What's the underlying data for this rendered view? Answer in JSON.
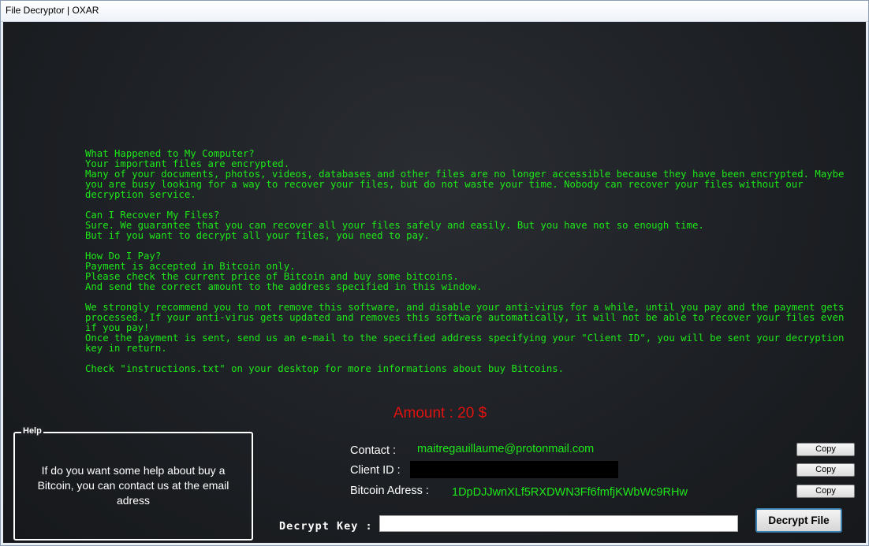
{
  "window": {
    "title": "File Decryptor | OXAR"
  },
  "note": {
    "paragraphs": [
      [
        "What Happened to My Computer?",
        "Your important files are encrypted.",
        "Many of your documents, photos, videos, databases and other files are no longer accessible because they have been encrypted. Maybe you are busy looking for a way to recover your files, but do not waste your time. Nobody can recover your files without our decryption service."
      ],
      [
        "Can I Recover My Files?",
        "Sure. We guarantee that you can recover all your files safely and easily. But you have not so enough time.",
        "But if you want to decrypt all your files, you need to pay."
      ],
      [
        "How Do I Pay?",
        "Payment is accepted in Bitcoin only.",
        "Please check the current price of Bitcoin and buy some bitcoins.",
        "And send the correct amount to the address specified in this window."
      ],
      [
        "We strongly recommend you to not remove this software, and disable your anti-virus for a while, until you pay and the payment gets processed. If your anti-virus gets updated and removes this software automatically, it will not be able to recover your files even if you pay!",
        "Once the payment is sent, send us an e-mail to the specified address specifying your \"Client ID\", you will be sent your decryption key in return."
      ],
      [
        "Check \"instructions.txt\" on your desktop for more informations about buy Bitcoins."
      ]
    ]
  },
  "amount": "Amount : 20 $",
  "help": {
    "legend": "Help",
    "text": "If do you want some help about buy a Bitcoin, you can contact us at the email adress"
  },
  "contact": {
    "label": "Contact :",
    "value": "maitregauillaume@protonmail.com"
  },
  "client_id": {
    "label": "Client ID :"
  },
  "bitcoin": {
    "label": "Bitcoin Adress :",
    "value": "1DpDJJwnXLf5RXDWN3Ff6fmfjKWbWc9RHw"
  },
  "copy_label": "Copy",
  "decrypt": {
    "label": "Decrypt Key :",
    "input_value": "",
    "button_label": "Decrypt File"
  }
}
